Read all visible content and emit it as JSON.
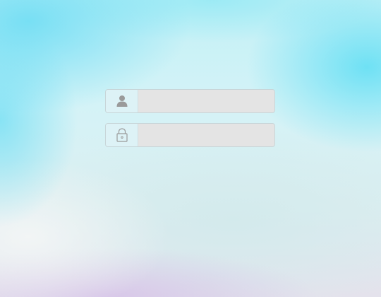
{
  "login": {
    "username": {
      "icon": "user-icon",
      "value": "",
      "placeholder": ""
    },
    "password": {
      "icon": "lock-icon",
      "value": "",
      "placeholder": ""
    }
  },
  "colors": {
    "field_background": "#e5e5e5",
    "field_border": "#c7d5d8",
    "icon_addon_background": "#dcf3f7",
    "icon_color": "#9a9a9a",
    "backdrop_cyan": "#5edef4",
    "backdrop_lavender": "#d6c4e8"
  }
}
